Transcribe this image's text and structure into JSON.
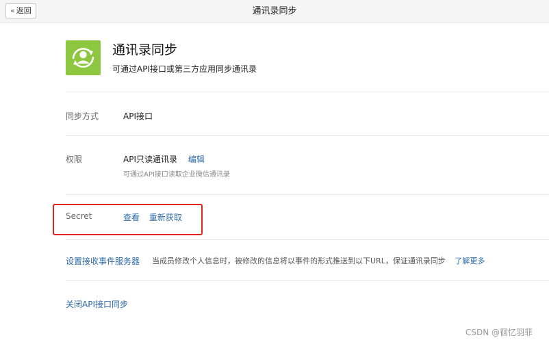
{
  "header": {
    "back_label": "返回",
    "title": "通讯录同步"
  },
  "app": {
    "icon": "contacts-sync-icon",
    "icon_color": "#8dc63f",
    "name": "通讯录同步",
    "description": "可通过API接口或第三方应用同步通讯录"
  },
  "rows": {
    "sync_mode": {
      "label": "同步方式",
      "value": "API接口"
    },
    "permission": {
      "label": "权限",
      "value": "API只读通讯录",
      "edit_label": "编辑",
      "description": "可通过API接口读取企业微信通讯录"
    },
    "secret": {
      "label": "Secret",
      "view_label": "查看",
      "refresh_label": "重新获取"
    },
    "event_server": {
      "link_label": "设置接收事件服务器",
      "description": "当成员修改个人信息时，被修改的信息将以事件的形式推送到以下URL，保证通讯录同步",
      "more_label": "了解更多"
    },
    "close_api": {
      "label": "关闭API接口同步"
    }
  },
  "colors": {
    "link": "#2d6aa8",
    "highlight_border": "#e2231a"
  },
  "watermark": "CSDN @徊忆羽菲"
}
